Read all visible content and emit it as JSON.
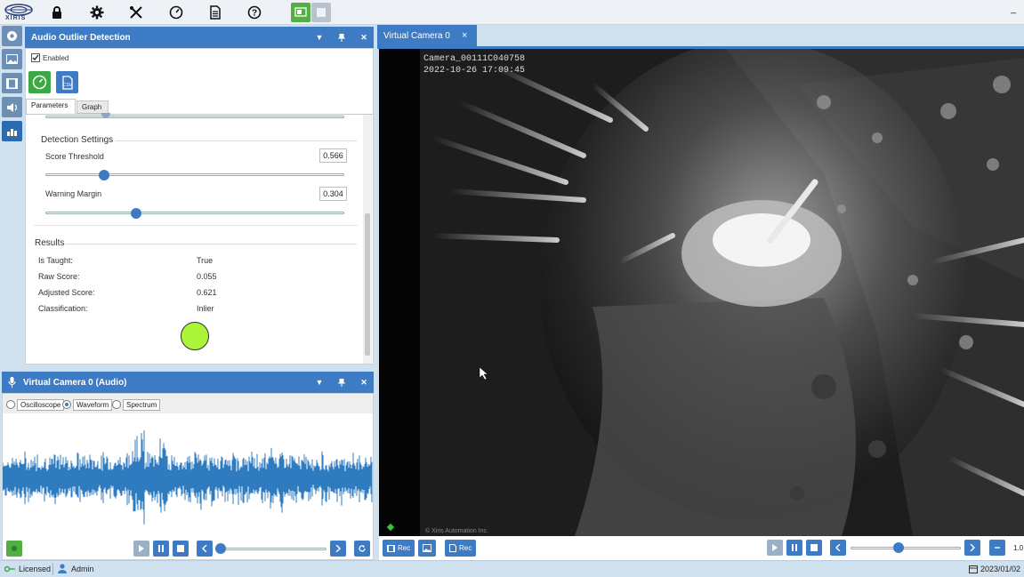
{
  "toolbar": {
    "logo": "XIRIS",
    "icons": [
      "lock-icon",
      "gear-icon",
      "tools-icon",
      "gauge-icon",
      "document-icon",
      "help-icon",
      "monitor-icon",
      "layout-icon"
    ],
    "minimize": "_"
  },
  "sidebar": {
    "icons": [
      "aperture-icon",
      "image-icon",
      "film-icon",
      "speaker-icon",
      "graph-hand-icon"
    ]
  },
  "outlier_panel": {
    "title": "Audio Outlier Detection",
    "enabled_label": "Enabled",
    "tabs": [
      "Parameters",
      "Graph"
    ],
    "detection_title": "Detection Settings",
    "score_threshold_label": "Score Threshold",
    "score_threshold_value": "0.566",
    "score_threshold_fraction": 0.196,
    "warning_margin_label": "Warning Margin",
    "warning_margin_value": "0.304",
    "warning_margin_fraction": 0.304,
    "results_title": "Results",
    "results": [
      {
        "label": "Is Taught:",
        "value": "True"
      },
      {
        "label": "Raw Score:",
        "value": "0.055"
      },
      {
        "label": "Adjusted Score:",
        "value": "0.621"
      },
      {
        "label": "Classification:",
        "value": "Inlier"
      }
    ],
    "indicator_color": "#aaf53a"
  },
  "audio_panel": {
    "title": "Virtual Camera 0 (Audio)",
    "modes": [
      "Oscilloscope",
      "Waveform",
      "Spectrum"
    ],
    "selected_mode": "Waveform",
    "waveform_color": "#2f7bc0"
  },
  "camera_panel": {
    "tab_title": "Virtual Camera 0",
    "tab_close": "×",
    "overlay_id": "Camera_00111C040758",
    "overlay_time": "2022-10-26 17:09:45",
    "watermark": "© Xiris Automation Inc.",
    "rec_labels": [
      "Rec",
      "Rec"
    ],
    "speed": "1.0"
  },
  "status": {
    "licensed": "Licensed",
    "user": "Admin",
    "date": "2023/01/02"
  },
  "colors": {
    "accent": "#3d7cc4",
    "panel_bg": "#cfe0ef"
  }
}
